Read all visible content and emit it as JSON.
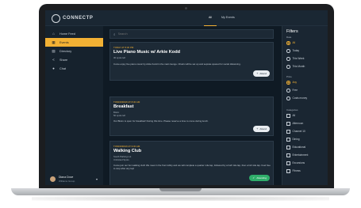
{
  "app": {
    "logo_text": "CONNECTP",
    "logo_icon": "circle-logo"
  },
  "top_tabs": [
    {
      "label": "All",
      "active": true
    },
    {
      "label": "My Events",
      "active": false
    }
  ],
  "sidebar": {
    "items": [
      {
        "label": "Home Feed",
        "icon": "home-icon"
      },
      {
        "label": "Events",
        "icon": "calendar-icon",
        "active": true
      },
      {
        "label": "Directory",
        "icon": "book-icon"
      },
      {
        "label": "Share",
        "icon": "share-icon"
      },
      {
        "label": "Chat",
        "icon": "chat-icon"
      }
    ],
    "user": {
      "name": "Diana Dove",
      "subtitle": "Williams Group"
    }
  },
  "search": {
    "placeholder": "Search"
  },
  "events": [
    {
      "date": "TODAY AT 8:30 PM",
      "title": "Live Piano Music w/ Arkie Kodd",
      "meta": [
        "30 spots left"
      ],
      "description": "Come enjoy live piano music by Arkie Kodd in the main lounge. Chairs will be set up and seprate spaced for social distancing.",
      "button": {
        "label": "Attend",
        "icon": "plus-icon",
        "state": "attend"
      }
    },
    {
      "date": "TOMORROW AT 8:30 AM",
      "title": "Breakfast",
      "meta": [
        "Bistro",
        "50 spots left"
      ],
      "description": "Our Bistro is open for breakfast! During this time. Please reserve a time to come during lunch.",
      "button": {
        "label": "Attend",
        "icon": "plus-icon",
        "state": "attend"
      }
    },
    {
      "date": "TOMORROW AT 9:30 AM",
      "title": "Walking Club",
      "meta": [
        "South Parking Lot",
        "Unlimited Spots"
      ],
      "description": "Come join our fun walking club! We meet in the front lobby and we will complete a quarter mile lap, followed by a half mile lap, then a full mile lap. Feel free to stop after any lap!",
      "button": {
        "label": "Attending",
        "icon": "check-icon",
        "state": "attending"
      }
    }
  ],
  "filters": {
    "title": "Filters",
    "sections": [
      {
        "label": "Date",
        "type": "radio",
        "options": [
          {
            "label": "All",
            "selected": true
          },
          {
            "label": "Today",
            "selected": false
          },
          {
            "label": "This Week",
            "selected": false
          },
          {
            "label": "This Month",
            "selected": false
          }
        ]
      },
      {
        "label": "Price",
        "type": "radio",
        "options": [
          {
            "label": "Any",
            "selected": true
          },
          {
            "label": "Free",
            "selected": false
          },
          {
            "label": "Costs money",
            "selected": false
          }
        ]
      },
      {
        "label": "Categories",
        "type": "checkbox",
        "options": [
          {
            "label": "All",
            "selected": false
          },
          {
            "label": "Afternoon",
            "selected": false
          },
          {
            "label": "Channel 10",
            "selected": false
          },
          {
            "label": "Dining",
            "selected": false
          },
          {
            "label": "Educational",
            "selected": false
          },
          {
            "label": "Entertainment",
            "selected": false
          },
          {
            "label": "Excursions",
            "selected": false
          },
          {
            "label": "Fitness",
            "selected": false
          }
        ]
      }
    ]
  },
  "colors": {
    "accent": "#f2b134",
    "bg": "#0f1a24",
    "card": "#1d2a36",
    "success": "#2fae6a"
  }
}
